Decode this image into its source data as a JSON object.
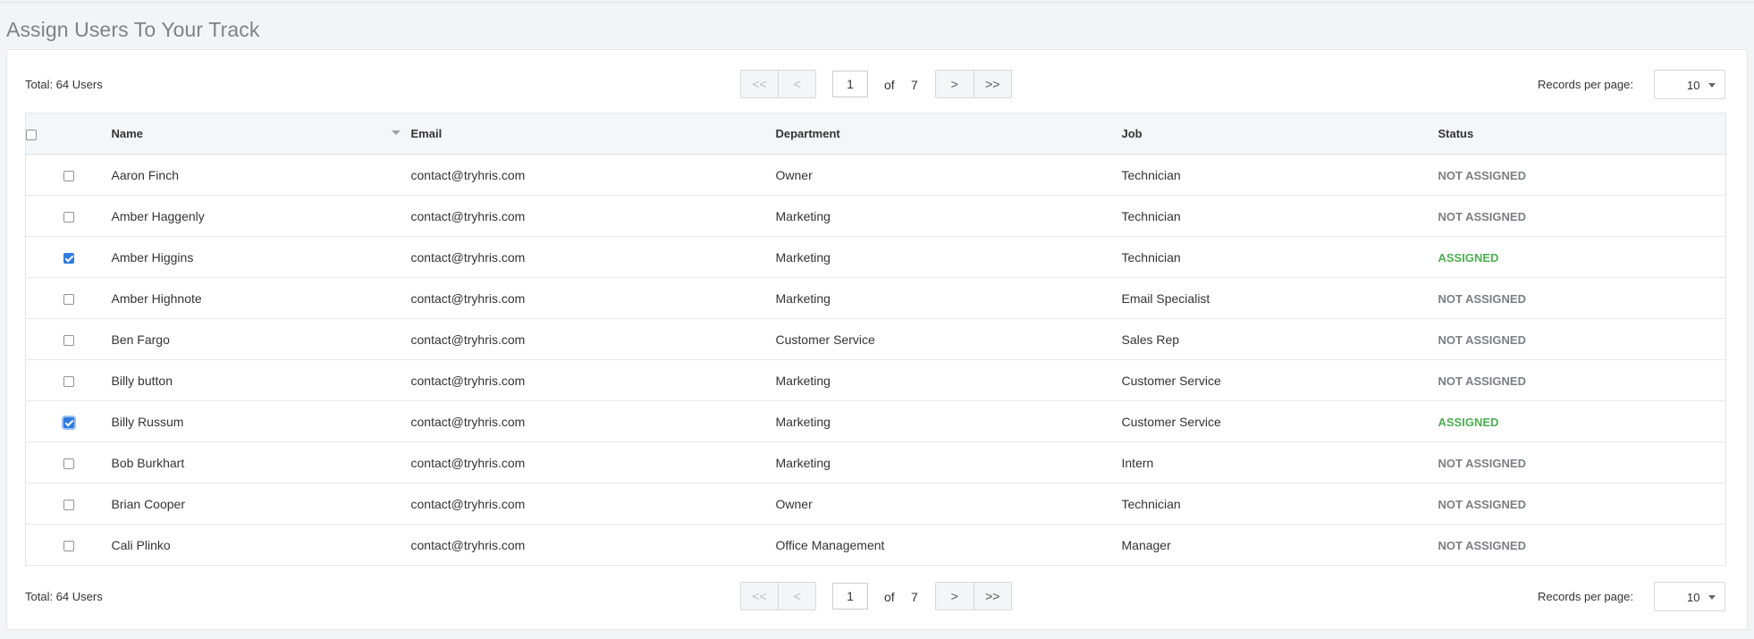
{
  "page": {
    "title": "Assign Users To Your Track"
  },
  "pagination": {
    "total": "Total: 64 Users",
    "first": "<<",
    "prev": "<",
    "next": ">",
    "last": ">>",
    "current_page": "1",
    "of": "of",
    "total_pages": "7",
    "records_label": "Records per page:",
    "records_value": "10"
  },
  "table": {
    "headers": {
      "name": "Name",
      "email": "Email",
      "department": "Department",
      "job": "Job",
      "status": "Status"
    },
    "rows": [
      {
        "checked": false,
        "name": "Aaron Finch",
        "email": "contact@tryhris.com",
        "department": "Owner",
        "job": "Technician",
        "status": "NOT ASSIGNED"
      },
      {
        "checked": false,
        "name": "Amber Haggenly",
        "email": "contact@tryhris.com",
        "department": "Marketing",
        "job": "Technician",
        "status": "NOT ASSIGNED"
      },
      {
        "checked": true,
        "name": "Amber Higgins",
        "email": "contact@tryhris.com",
        "department": "Marketing",
        "job": "Technician",
        "status": "ASSIGNED"
      },
      {
        "checked": false,
        "name": "Amber Highnote",
        "email": "contact@tryhris.com",
        "department": "Marketing",
        "job": "Email Specialist",
        "status": "NOT ASSIGNED"
      },
      {
        "checked": false,
        "name": "Ben Fargo",
        "email": "contact@tryhris.com",
        "department": "Customer Service",
        "job": "Sales Rep",
        "status": "NOT ASSIGNED"
      },
      {
        "checked": false,
        "name": "Billy button",
        "email": "contact@tryhris.com",
        "department": "Marketing",
        "job": "Customer Service",
        "status": "NOT ASSIGNED"
      },
      {
        "checked": true,
        "name": "Billy Russum",
        "email": "contact@tryhris.com",
        "department": "Marketing",
        "job": "Customer Service",
        "status": "ASSIGNED"
      },
      {
        "checked": false,
        "name": "Bob Burkhart",
        "email": "contact@tryhris.com",
        "department": "Marketing",
        "job": "Intern",
        "status": "NOT ASSIGNED"
      },
      {
        "checked": false,
        "name": "Brian Cooper",
        "email": "contact@tryhris.com",
        "department": "Owner",
        "job": "Technician",
        "status": "NOT ASSIGNED"
      },
      {
        "checked": false,
        "name": "Cali Plinko",
        "email": "contact@tryhris.com",
        "department": "Office Management",
        "job": "Manager",
        "status": "NOT ASSIGNED"
      }
    ]
  },
  "colors": {
    "assigned": "#4caf50",
    "not_assigned": "#7a7f85",
    "checkbox": "#2f7be0"
  }
}
